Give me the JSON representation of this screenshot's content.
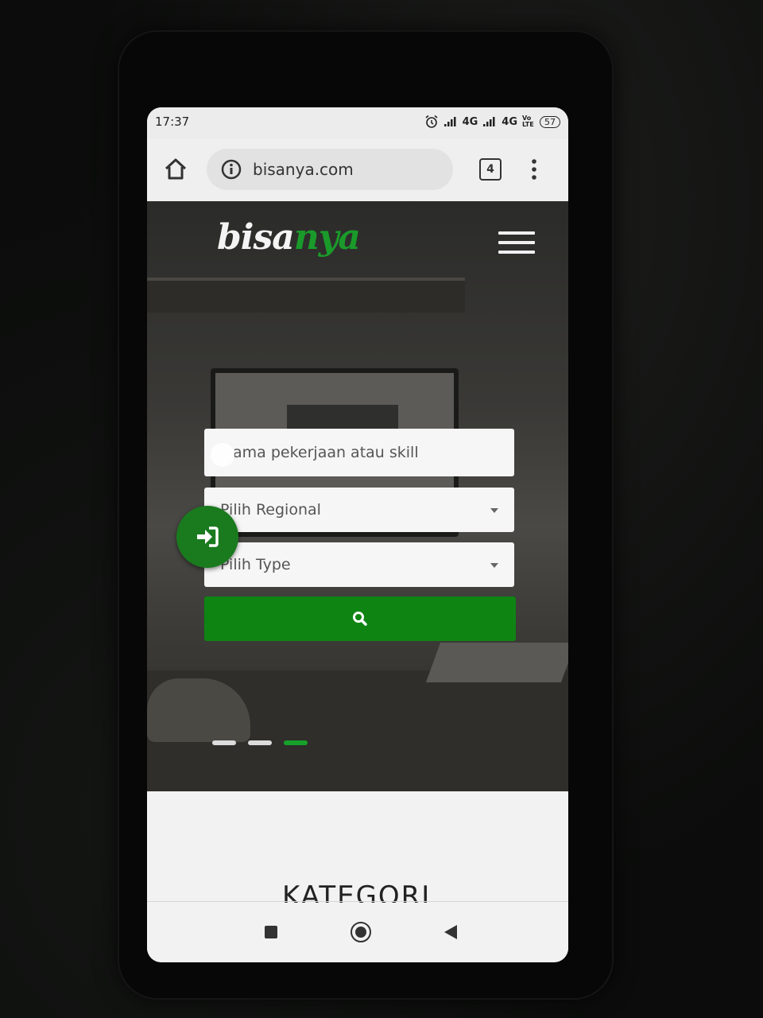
{
  "status_bar": {
    "time": "17:37",
    "network_1": "4G",
    "network_2": "4G",
    "volte": "Vo LTE",
    "battery": "57",
    "icons": [
      "alarm-icon",
      "signal-icon",
      "signal-icon",
      "volte-icon",
      "battery-icon"
    ]
  },
  "browser": {
    "url": "bisanya.com",
    "tab_count": "4",
    "icons": [
      "home-icon",
      "info-icon",
      "tabs-icon",
      "menu-dots-icon"
    ]
  },
  "site": {
    "logo_part1": "bisa",
    "logo_part2": "nya",
    "brand_color": "#0e8413",
    "skill_placeholder": "Nama pekerjaan atau skill",
    "skill_visible_text": "ama pekerjaan atau skill",
    "region_select": "Pilih Regional",
    "type_select": "Pilih Type",
    "slider_active_index": 2,
    "slider_count": 3,
    "section_title": "KATEGORI",
    "icons": [
      "hamburger-menu-icon",
      "search-icon",
      "login-icon"
    ]
  },
  "nav_bar": {
    "icons": [
      "recent-apps-icon",
      "home-circle-icon",
      "back-icon"
    ]
  }
}
